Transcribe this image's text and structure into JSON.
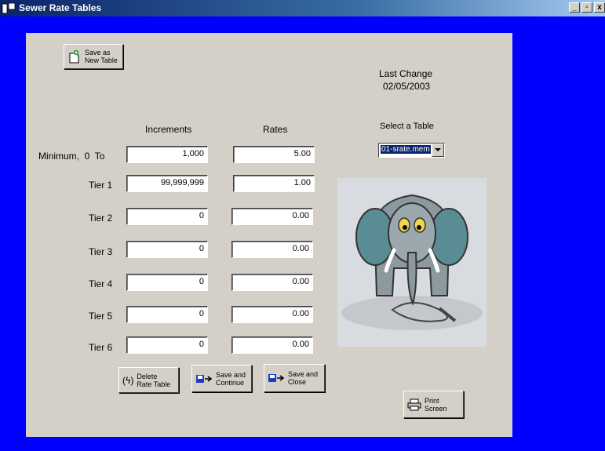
{
  "window": {
    "title": "Sewer Rate Tables"
  },
  "buttons": {
    "save_new": "Save as\nNew Table",
    "delete": "Delete\nRate Table",
    "save_continue": "Save and\nContinue",
    "save_close": "Save and\nClose",
    "print": "Print\nScreen"
  },
  "last_change": {
    "label": "Last Change",
    "date": "02/05/2003"
  },
  "headers": {
    "increments": "Increments",
    "rates": "Rates"
  },
  "select_table": {
    "label": "Select a Table",
    "value": "01-srate.mem"
  },
  "rows": [
    {
      "label": "Minimum,  0  To",
      "increment": "1,000",
      "rate": "5.00"
    },
    {
      "label": "Tier 1",
      "increment": "99,999,999",
      "rate": "1.00"
    },
    {
      "label": "Tier 2",
      "increment": "0",
      "rate": "0.00"
    },
    {
      "label": "Tier 3",
      "increment": "0",
      "rate": "0.00"
    },
    {
      "label": "Tier 4",
      "increment": "0",
      "rate": "0.00"
    },
    {
      "label": "Tier 5",
      "increment": "0",
      "rate": "0.00"
    },
    {
      "label": "Tier 6",
      "increment": "0",
      "rate": "0.00"
    }
  ],
  "icons": [
    "app-icon",
    "add-document-icon",
    "delete-icon",
    "save-disk-icon",
    "printer-icon",
    "elephant-illustration"
  ]
}
